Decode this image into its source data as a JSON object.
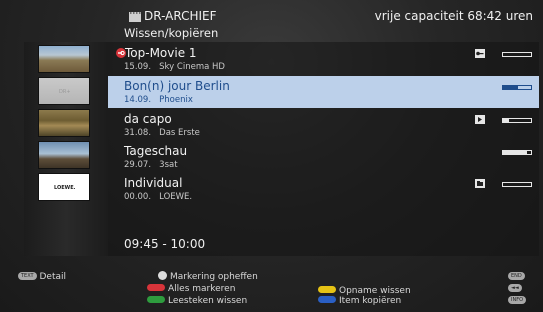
{
  "header": {
    "icon": "film-archive-icon",
    "title": "DR-ARCHIEF",
    "subtitle": "Wissen/kopiëren",
    "capacity": "vrije capaciteit 68:42 uren"
  },
  "thumbnails": [
    {
      "name": "landscape-castle",
      "label": ""
    },
    {
      "name": "grey-placeholder",
      "label": "DR+"
    },
    {
      "name": "field-scene",
      "label": ""
    },
    {
      "name": "church-scene",
      "label": ""
    },
    {
      "name": "loewe-logo",
      "label": "LOEWE."
    }
  ],
  "recordings": [
    {
      "title": "Top-Movie 1",
      "date": "15.09.",
      "channel": "Sky Cinema HD",
      "locked": true,
      "flag_icon": "key-icon",
      "progress": 0.0,
      "selected": false
    },
    {
      "title": "Bon(n) jour Berlin",
      "date": "14.09.",
      "channel": "Phoenix",
      "locked": false,
      "flag_icon": "",
      "progress": 0.55,
      "selected": true
    },
    {
      "title": "da capo",
      "date": "31.08.",
      "channel": "Das Erste",
      "locked": false,
      "flag_icon": "play-marker-icon",
      "progress": 0.2,
      "selected": false
    },
    {
      "title": "Tageschau",
      "date": "29.07.",
      "channel": "3sat",
      "locked": false,
      "flag_icon": "",
      "progress": 0.85,
      "selected": false
    },
    {
      "title": "Individual",
      "date": "00.00.",
      "channel": "LOEWE.",
      "locked": false,
      "flag_icon": "folder-icon",
      "progress": 0.0,
      "selected": false
    }
  ],
  "time_range": "09:45 - 10:00",
  "footer": {
    "detail_key": "TEXT",
    "detail_label": "Detail",
    "unmark_label": "Markering opheffen",
    "mark_all_label": "Alles markeren",
    "delete_bookmark_label": "Leesteken wissen",
    "delete_recording_label": "Opname wissen",
    "copy_item_label": "Item kopiëren",
    "end_key": "END",
    "rewind_key": "◄◄",
    "info_key": "INFO"
  },
  "colors": {
    "selection_bg": "#bcd0ea",
    "selection_text": "#1f4d8c",
    "lock_red": "#d8343a",
    "red_key": "#d8343a",
    "green_key": "#2e9c3e",
    "yellow_key": "#e6c315",
    "blue_key": "#2a5fc4"
  }
}
